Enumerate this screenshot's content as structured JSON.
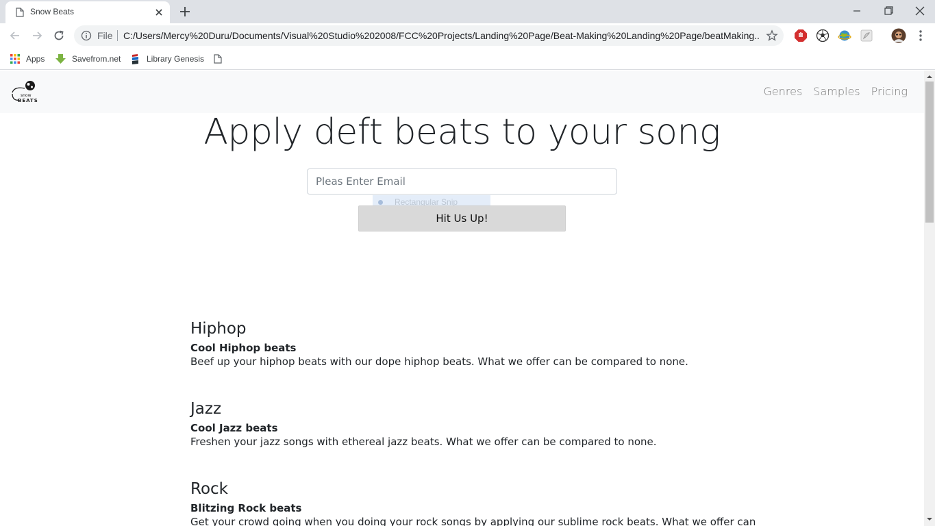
{
  "browser": {
    "tab_title": "Snow Beats",
    "file_label": "File",
    "url": "C:/Users/Mercy%20Duru/Documents/Visual%20Studio%202008/FCC%20Projects/Landing%20Page/Beat-Making%20Landing%20Page/beatMaking....",
    "bookmarks": [
      {
        "label": "Apps",
        "icon": "apps-grid-icon"
      },
      {
        "label": "Savefrom.net",
        "icon": "download-arrow-icon"
      },
      {
        "label": "Library Genesis",
        "icon": "library-icon"
      }
    ]
  },
  "site": {
    "nav": {
      "links": [
        "Genres",
        "Samples",
        "Pricing"
      ]
    },
    "hero": {
      "title": "Apply deft beats to your song",
      "email_placeholder": "Pleas Enter Email",
      "button_label": "Hit Us Up!",
      "ghost_overlay_text": "Rectangular Snip"
    },
    "genres": [
      {
        "title": "Hiphop",
        "subtitle": "Cool Hiphop beats",
        "description": "Beef up your hiphop beats with our dope hiphop beats. What we offer can be compared to none."
      },
      {
        "title": "Jazz",
        "subtitle": "Cool Jazz beats",
        "description": "Freshen your jazz songs with ethereal jazz beats. What we offer can be compared to none."
      },
      {
        "title": "Rock",
        "subtitle": "Blitzing Rock beats",
        "description": "Get your crowd going when you doing your rock songs by applying our sublime rock beats. What we offer can"
      }
    ]
  },
  "colors": {
    "chrome_bg": "#dee1e6",
    "nav_bg": "#f8f9fa",
    "button_bg": "#d9d9d9",
    "text": "#212529"
  }
}
